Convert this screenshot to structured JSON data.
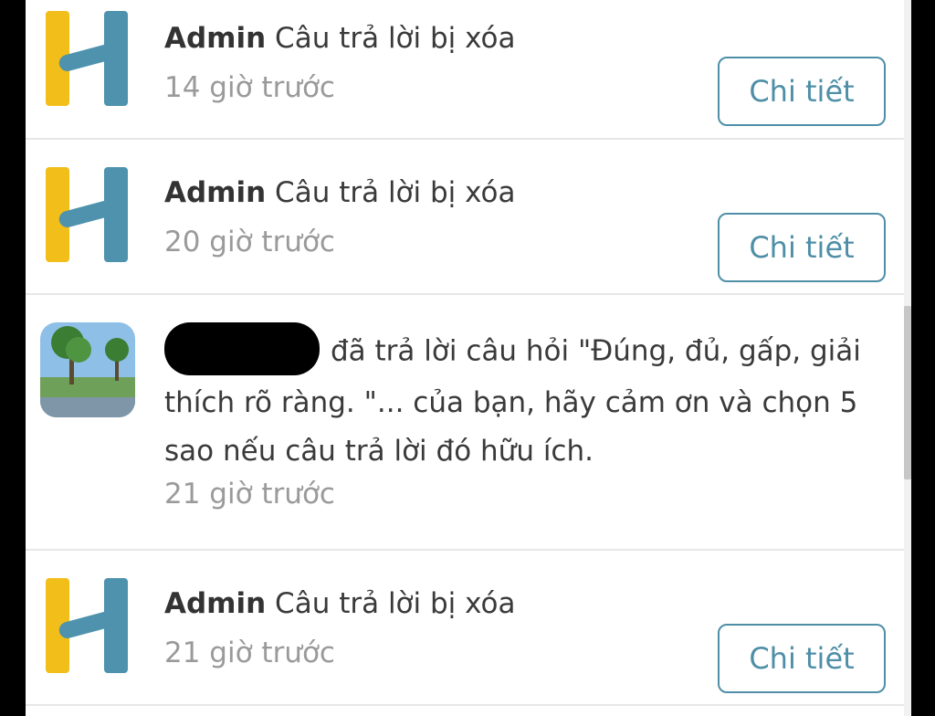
{
  "colors": {
    "logo_yellow": "#f2be1a",
    "logo_blue": "#4e92ad",
    "button_border": "#4e8fa7",
    "muted_time": "#9a9a9a"
  },
  "notifications": [
    {
      "sender": "Admin",
      "message": "Câu trả lời bị xóa",
      "time": "14 giờ trước",
      "button": "Chi tiết",
      "avatar_icon": "h-logo-icon"
    },
    {
      "sender": "Admin",
      "message": "Câu trả lời bị xóa",
      "time": "20 giờ trước",
      "button": "Chi tiết",
      "avatar_icon": "h-logo-icon"
    },
    {
      "sender": "",
      "message": "đã trả lời câu hỏi \"Đúng, đủ, gấp, giải thích rõ ràng. \"... của bạn, hãy cảm ơn và chọn 5 sao nếu câu trả lời đó hữu ích.",
      "time": "21 giờ trước",
      "avatar_icon": "landscape-avatar"
    },
    {
      "sender": "Admin",
      "message": "Câu trả lời bị xóa",
      "time": "21 giờ trước",
      "button": "Chi tiết",
      "avatar_icon": "h-logo-icon"
    }
  ]
}
